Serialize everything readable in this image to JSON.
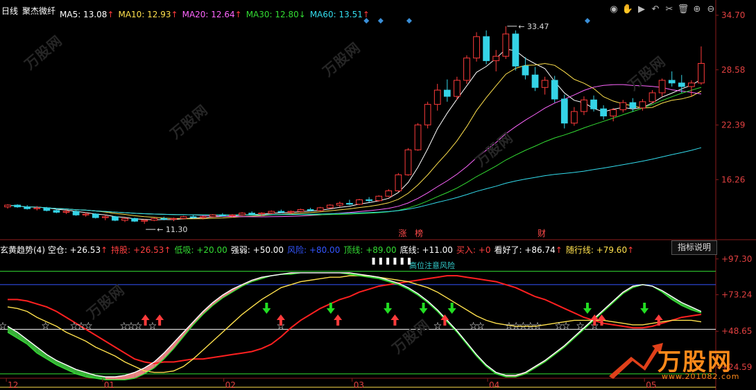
{
  "header": {
    "period": "日线",
    "stock_name": "聚杰微纤",
    "ma": [
      {
        "label": "MA5: 13.08",
        "arrow": "↑",
        "color": "#ffffff",
        "arrow_color": "#ff3b3b"
      },
      {
        "label": "MA10: 12.93",
        "arrow": "↑",
        "color": "#ffe14d",
        "arrow_color": "#ff3b3b"
      },
      {
        "label": "MA20: 12.64",
        "arrow": "↑",
        "color": "#ff66ff",
        "arrow_color": "#ff3b3b"
      },
      {
        "label": "MA30: 12.80",
        "arrow": "↓",
        "color": "#33dd33",
        "arrow_color": "#33dd33"
      },
      {
        "label": "MA60: 13.51",
        "arrow": "↑",
        "color": "#33ddee",
        "arrow_color": "#ff3b3b"
      }
    ]
  },
  "toolbar": {
    "icons": [
      "eye-icon",
      "hand-icon",
      "play-icon",
      "undo-icon",
      "scissors-icon",
      "trash-icon",
      "zoom-in-icon",
      "zoom-out-icon"
    ],
    "glyphs": [
      "◉",
      "✋",
      "▶",
      "↶",
      "✂",
      "🗑",
      "⊕",
      "⊖"
    ]
  },
  "indicator": {
    "items": [
      {
        "text": "玄黄趋势(4) 空仓: +26.53",
        "arrow": "↑",
        "color": "#ffffff"
      },
      {
        "text": "持股: +26.53",
        "arrow": "↑",
        "color": "#ff4040"
      },
      {
        "text": "低吸: +20.00",
        "arrow": "",
        "color": "#33dd33"
      },
      {
        "text": "强弱: +50.00",
        "arrow": "",
        "color": "#ffffff"
      },
      {
        "text": "风险: +80.00",
        "arrow": "",
        "color": "#3355ff"
      },
      {
        "text": "顶线: +89.00",
        "arrow": "",
        "color": "#33dd33"
      },
      {
        "text": "底线: +11.00",
        "arrow": "",
        "color": "#ffffff"
      },
      {
        "text": "买入: +0",
        "arrow": "",
        "color": "#ff4040"
      },
      {
        "text": "看好了: +86.74",
        "arrow": "↑",
        "color": "#ffffff"
      },
      {
        "text": "随行线: +79.60",
        "arrow": "↑",
        "color": "#ffe14d"
      }
    ],
    "help_label": "指标说明",
    "annotation": "高位注意风险"
  },
  "badges": {
    "zhang": "涨",
    "bang": "榜",
    "cai": "财"
  },
  "watermark": {
    "text": "万股网",
    "url": "www.201082.com"
  },
  "chart_data": [
    {
      "type": "candlestick",
      "yticks": [
        "34.70",
        "28.58",
        "22.39",
        "16.26"
      ],
      "ylim": [
        10.3,
        34.7
      ],
      "annotations": [
        {
          "label": "33.47",
          "value": 33.47
        },
        {
          "label": "11.30",
          "value": 11.3
        }
      ],
      "xticks": [
        "12",
        "01",
        "02",
        "03",
        "04",
        "05"
      ],
      "ohlc": [
        [
          13.2,
          13.5,
          13.0,
          13.4
        ],
        [
          13.4,
          13.5,
          13.1,
          13.2
        ],
        [
          13.2,
          13.4,
          12.9,
          13.0
        ],
        [
          13.0,
          13.3,
          12.8,
          13.1
        ],
        [
          13.1,
          13.2,
          12.7,
          12.8
        ],
        [
          12.8,
          13.0,
          12.5,
          12.6
        ],
        [
          12.6,
          12.9,
          12.4,
          12.7
        ],
        [
          12.7,
          12.8,
          12.2,
          12.3
        ],
        [
          12.3,
          12.6,
          12.1,
          12.4
        ],
        [
          12.4,
          12.5,
          11.9,
          12.0
        ],
        [
          12.0,
          12.3,
          11.7,
          12.1
        ],
        [
          12.1,
          12.2,
          11.6,
          11.7
        ],
        [
          11.7,
          12.0,
          11.5,
          11.9
        ],
        [
          11.9,
          12.0,
          11.5,
          11.6
        ],
        [
          11.6,
          11.8,
          11.3,
          11.7
        ],
        [
          11.7,
          12.0,
          11.6,
          11.9
        ],
        [
          11.9,
          12.1,
          11.7,
          11.8
        ],
        [
          11.8,
          12.0,
          11.6,
          11.9
        ],
        [
          11.9,
          12.2,
          11.8,
          12.1
        ],
        [
          12.1,
          12.3,
          11.9,
          12.0
        ],
        [
          12.0,
          12.2,
          11.8,
          12.1
        ],
        [
          12.1,
          12.4,
          12.0,
          12.3
        ],
        [
          12.3,
          12.5,
          12.1,
          12.2
        ],
        [
          12.2,
          12.4,
          12.0,
          12.3
        ],
        [
          12.3,
          12.6,
          12.2,
          12.5
        ],
        [
          12.5,
          12.7,
          12.3,
          12.4
        ],
        [
          12.4,
          12.6,
          12.2,
          12.5
        ],
        [
          12.5,
          12.8,
          12.4,
          12.7
        ],
        [
          12.7,
          12.9,
          12.5,
          12.6
        ],
        [
          12.6,
          12.8,
          12.4,
          12.7
        ],
        [
          12.7,
          13.0,
          12.6,
          12.9
        ],
        [
          12.9,
          13.1,
          12.7,
          12.8
        ],
        [
          12.8,
          13.2,
          12.7,
          13.1
        ],
        [
          13.1,
          13.5,
          13.0,
          13.4
        ],
        [
          13.4,
          13.8,
          13.2,
          13.6
        ],
        [
          13.6,
          14.0,
          13.4,
          13.5
        ],
        [
          13.5,
          14.1,
          13.4,
          14.0
        ],
        [
          14.0,
          14.3,
          13.7,
          13.9
        ],
        [
          13.9,
          14.5,
          13.8,
          14.4
        ],
        [
          14.4,
          15.2,
          14.3,
          15.0
        ],
        [
          15.0,
          17.0,
          14.9,
          16.8
        ],
        [
          16.8,
          19.8,
          16.7,
          19.6
        ],
        [
          19.6,
          22.6,
          19.5,
          22.4
        ],
        [
          22.4,
          25.0,
          22.0,
          24.7
        ],
        [
          24.7,
          27.0,
          24.0,
          26.3
        ],
        [
          26.3,
          27.5,
          25.0,
          25.6
        ],
        [
          25.6,
          27.8,
          25.2,
          27.4
        ],
        [
          27.4,
          30.2,
          27.0,
          29.9
        ],
        [
          29.9,
          32.8,
          29.5,
          32.3
        ],
        [
          32.3,
          33.0,
          29.2,
          29.6
        ],
        [
          29.6,
          30.8,
          28.4,
          30.1
        ],
        [
          30.1,
          33.47,
          29.8,
          32.6
        ],
        [
          32.6,
          33.0,
          28.5,
          29.0
        ],
        [
          29.0,
          30.0,
          27.5,
          28.0
        ],
        [
          28.0,
          28.9,
          26.2,
          26.6
        ],
        [
          26.6,
          27.8,
          25.8,
          27.4
        ],
        [
          27.4,
          27.9,
          24.9,
          25.3
        ],
        [
          25.3,
          25.8,
          22.0,
          22.6
        ],
        [
          22.6,
          24.4,
          22.3,
          23.9
        ],
        [
          23.9,
          25.6,
          23.5,
          25.2
        ],
        [
          25.2,
          25.7,
          23.9,
          24.2
        ],
        [
          24.2,
          24.6,
          23.0,
          23.4
        ],
        [
          23.4,
          24.3,
          22.8,
          24.1
        ],
        [
          24.1,
          25.2,
          23.8,
          24.9
        ],
        [
          24.9,
          25.4,
          23.9,
          24.3
        ],
        [
          24.3,
          25.3,
          24.0,
          25.0
        ],
        [
          25.0,
          26.3,
          24.8,
          26.0
        ],
        [
          26.0,
          27.6,
          25.6,
          27.4
        ],
        [
          27.4,
          28.4,
          26.7,
          27.1
        ],
        [
          27.1,
          28.0,
          26.0,
          26.7
        ],
        [
          26.7,
          27.4,
          25.6,
          27.1
        ],
        [
          27.1,
          31.2,
          26.9,
          29.3
        ]
      ],
      "ma_series": [
        {
          "name": "MA5",
          "color": "#ffffff"
        },
        {
          "name": "MA10",
          "color": "#ffe14d"
        },
        {
          "name": "MA20",
          "color": "#ff66ff"
        },
        {
          "name": "MA30",
          "color": "#33dd33"
        },
        {
          "name": "MA60",
          "color": "#33ddee"
        }
      ]
    },
    {
      "type": "line",
      "yticks": [
        "+97.30",
        "+73.24",
        "+48.65",
        "+24.59"
      ],
      "ylim": [
        18,
        100
      ],
      "hlines": [
        {
          "value": 89,
          "color": "#33dd33"
        },
        {
          "value": 80,
          "color": "#3355ff"
        },
        {
          "value": 50,
          "color": "#ffffff"
        },
        {
          "value": 20,
          "color": "#33dd33"
        },
        {
          "value": 11,
          "color": "#ffe14d"
        }
      ],
      "series": [
        {
          "color": "#ff2020",
          "values": [
            70,
            70,
            69,
            67,
            65,
            62,
            58,
            54,
            50,
            46,
            42,
            38,
            34,
            30,
            28,
            27,
            28,
            28,
            29,
            30,
            30,
            31,
            32,
            33,
            34,
            35,
            37,
            40,
            45,
            51,
            56,
            60,
            64,
            67,
            70,
            72,
            75,
            77,
            79,
            80,
            81,
            82,
            83,
            84,
            85,
            86,
            86,
            85,
            84,
            83,
            82,
            80,
            78,
            75,
            72,
            70,
            67,
            64,
            61,
            58,
            56,
            54,
            53,
            52,
            51,
            51,
            52,
            54,
            56,
            58,
            59,
            60
          ]
        },
        {
          "color": "#ffe14d",
          "values": [
            65,
            64,
            62,
            58,
            55,
            52,
            48,
            45,
            42,
            38,
            35,
            32,
            28,
            25,
            22,
            21,
            21,
            22,
            25,
            30,
            36,
            42,
            48,
            54,
            60,
            65,
            70,
            74,
            78,
            80,
            82,
            83,
            84,
            85,
            85,
            86,
            86,
            86,
            85,
            84,
            83,
            82,
            80,
            78,
            75,
            71,
            67,
            63,
            59,
            56,
            54,
            53,
            52,
            52,
            52,
            53,
            54,
            55,
            56,
            56,
            56,
            56,
            55,
            54,
            53,
            53,
            54,
            55,
            56,
            56,
            56,
            55
          ]
        },
        {
          "color": "#33dd33",
          "values": [
            48,
            44,
            40,
            34,
            30,
            26,
            23,
            20,
            18,
            17,
            16,
            16,
            16,
            17,
            20,
            24,
            30,
            37,
            45,
            53,
            60,
            66,
            71,
            75,
            79,
            82,
            84,
            86,
            87,
            87,
            88,
            88,
            88,
            88,
            88,
            87,
            86,
            85,
            84,
            82,
            80,
            77,
            73,
            68,
            62,
            55,
            48,
            40,
            32,
            25,
            20,
            18,
            18,
            20,
            24,
            28,
            33,
            38,
            44,
            50,
            56,
            62,
            68,
            74,
            78,
            80,
            79,
            75,
            70,
            66,
            63,
            61
          ]
        },
        {
          "color": "#ffffff",
          "values": [
            52,
            48,
            43,
            38,
            33,
            29,
            26,
            23,
            21,
            19,
            18,
            18,
            19,
            21,
            24,
            28,
            34,
            41,
            48,
            55,
            62,
            68,
            73,
            77,
            80,
            83,
            85,
            86,
            87,
            88,
            88,
            88,
            88,
            88,
            88,
            88,
            87,
            86,
            85,
            83,
            81,
            78,
            74,
            69,
            63,
            56,
            49,
            41,
            33,
            26,
            21,
            19,
            19,
            21,
            25,
            29,
            34,
            39,
            45,
            51,
            57,
            63,
            69,
            75,
            79,
            80,
            79,
            76,
            72,
            68,
            65,
            62
          ]
        }
      ],
      "stars": [
        0.0,
        0.06,
        0.1,
        0.11,
        0.12,
        0.17,
        0.18,
        0.19,
        0.21,
        0.39,
        0.61,
        0.66,
        0.67,
        0.71,
        0.72,
        0.73,
        0.74,
        0.75,
        0.78,
        0.79,
        0.81,
        0.83
      ],
      "buy": [
        0.2,
        0.22,
        0.39,
        0.47,
        0.55,
        0.62,
        0.83,
        0.84,
        0.92
      ],
      "sell": [
        0.37,
        0.46,
        0.54,
        0.59,
        0.63,
        0.82,
        0.9
      ]
    }
  ]
}
